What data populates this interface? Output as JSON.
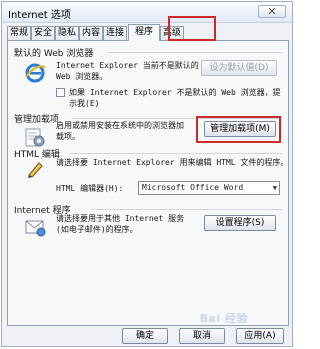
{
  "window": {
    "title": "Internet 选项",
    "close_label": "✕"
  },
  "tabs": [
    {
      "label": "常规",
      "active": false
    },
    {
      "label": "安全",
      "active": false
    },
    {
      "label": "隐私",
      "active": false
    },
    {
      "label": "内容",
      "active": false
    },
    {
      "label": "连接",
      "active": false
    },
    {
      "label": "程序",
      "active": true
    },
    {
      "label": "高级",
      "active": false
    }
  ],
  "default_browser": {
    "section_label": "默认的 Web 浏览器",
    "description_line1": "Internet Explorer 当前不是默认的",
    "description_line2": "Web 浏览器。",
    "set_default_button": "设为默认值(D)",
    "checkbox_label_line1": "如果 Internet Explorer 不是默认的 Web 浏览器，提",
    "checkbox_label_line2": "示我(E)",
    "checkbox_checked": false
  },
  "addons": {
    "section_label": "管理加载项",
    "description_line1": "启用或禁用安装在系统中的浏览器加",
    "description_line2": "载项。",
    "manage_button": "管理加载项(M)"
  },
  "html_editing": {
    "section_label": "HTML 编辑",
    "description": "请选择要 Internet Explorer 用来编辑 HTML 文件的程序。",
    "editor_label": "HTML 编辑器(H):",
    "editor_value": "Microsoft Office Word"
  },
  "internet_programs": {
    "section_label": "Internet 程序",
    "description_line1": "请选择要用于其他 Internet 服务",
    "description_line2": "(如电子邮件)的程序。",
    "set_programs_button": "设置程序(S)"
  },
  "footer": {
    "ok_button": "确定",
    "cancel_button": "取消",
    "apply_button": "应用(A)"
  },
  "watermark": "Bai 经验",
  "colors": {
    "highlight": "#cc2a2a",
    "window_bg": "#eef2f7",
    "panel_bg": "#f7f8fa"
  }
}
